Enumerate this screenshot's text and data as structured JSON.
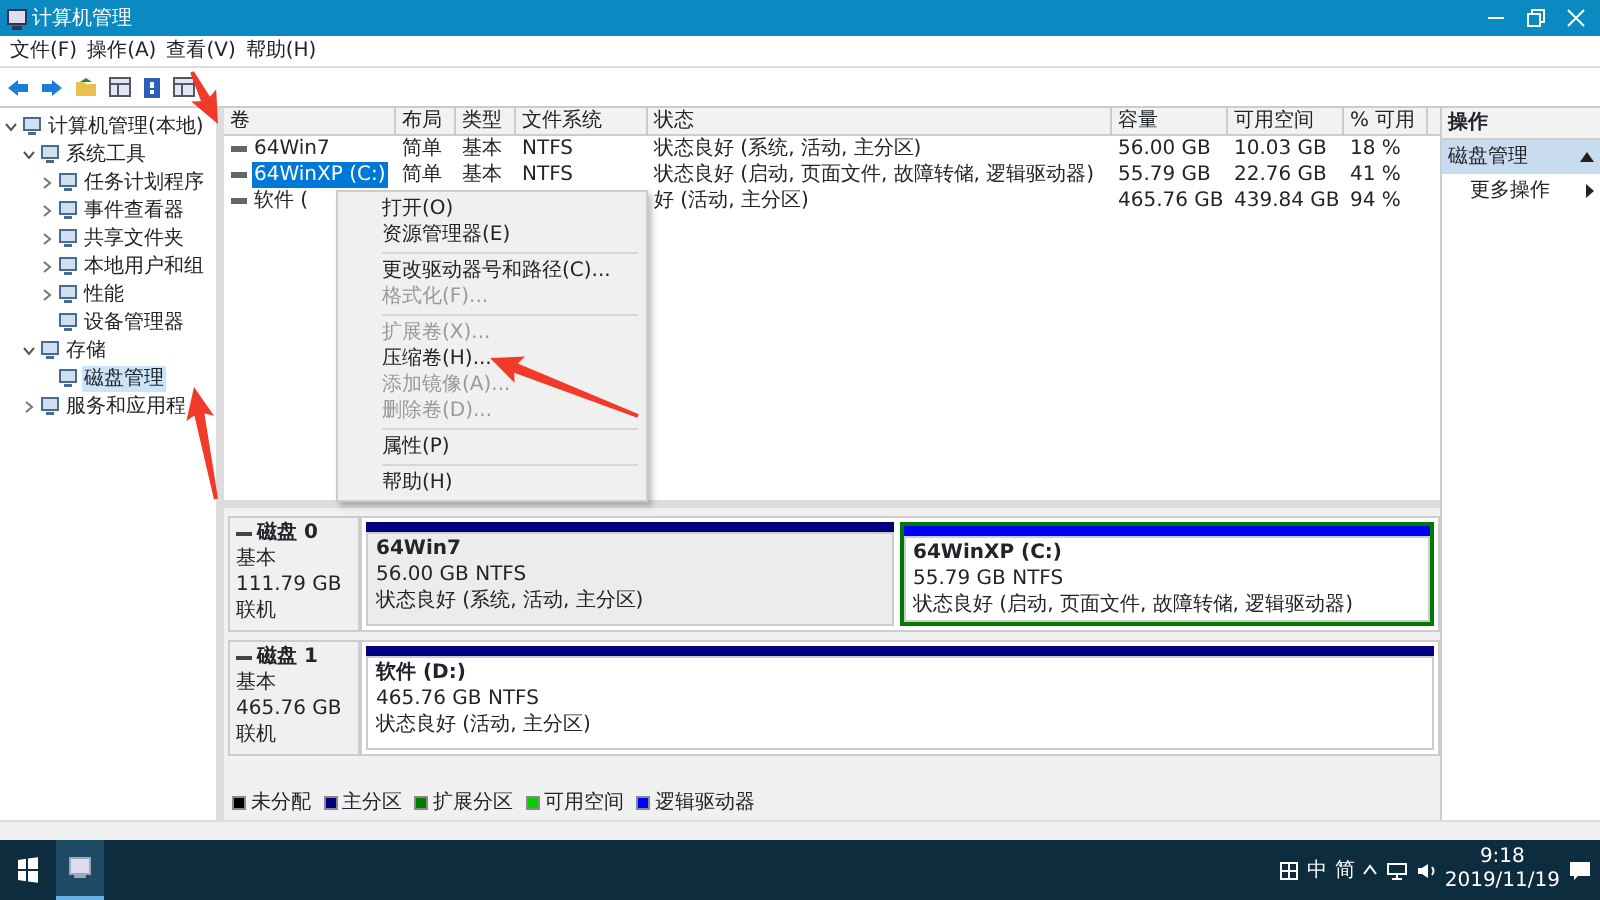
{
  "window": {
    "title": "计算机管理"
  },
  "menu_bar": [
    "文件(F)",
    "操作(A)",
    "查看(V)",
    "帮助(H)"
  ],
  "tree": [
    {
      "label": "计算机管理(本地)",
      "expanded": true,
      "selected": false,
      "children": [
        {
          "label": "系统工具",
          "expanded": true,
          "selected": false,
          "children": [
            {
              "label": "任务计划程序",
              "expanded": false,
              "selected": false
            },
            {
              "label": "事件查看器",
              "expanded": false,
              "selected": false
            },
            {
              "label": "共享文件夹",
              "expanded": false,
              "selected": false
            },
            {
              "label": "本地用户和组",
              "expanded": false,
              "selected": false
            },
            {
              "label": "性能",
              "expanded": false,
              "selected": false
            },
            {
              "label": "设备管理器",
              "selected": false
            }
          ]
        },
        {
          "label": "存储",
          "expanded": true,
          "selected": false,
          "children": [
            {
              "label": "磁盘管理",
              "selected": true
            }
          ]
        },
        {
          "label": "服务和应用程",
          "expanded": false,
          "selected": false
        }
      ]
    }
  ],
  "table": {
    "columns": [
      "卷",
      "布局",
      "类型",
      "文件系统",
      "状态",
      "容量",
      "可用空间",
      "% 可用"
    ],
    "rows": [
      {
        "selected": false,
        "cells": [
          "64Win7",
          "简单",
          "基本",
          "NTFS",
          "状态良好 (系统, 活动, 主分区)",
          "56.00 GB",
          "10.03 GB",
          "18 %"
        ]
      },
      {
        "selected": true,
        "cells": [
          "64WinXP (C:)",
          "简单",
          "基本",
          "NTFS",
          "状态良好 (启动, 页面文件, 故障转储, 逻辑驱动器)",
          "55.79 GB",
          "22.76 GB",
          "41 %"
        ]
      },
      {
        "selected": false,
        "cells": [
          "软件 (",
          "",
          "",
          "",
          "好 (活动, 主分区)",
          "465.76 GB",
          "439.84 GB",
          "94 %"
        ]
      }
    ]
  },
  "context_menu": [
    {
      "label": "打开(O)",
      "disabled": false
    },
    {
      "label": "资源管理器(E)",
      "disabled": false,
      "separator_after": true
    },
    {
      "label": "更改驱动器号和路径(C)...",
      "disabled": false
    },
    {
      "label": "格式化(F)...",
      "disabled": true,
      "separator_after": true
    },
    {
      "label": "扩展卷(X)...",
      "disabled": true
    },
    {
      "label": "压缩卷(H)...",
      "disabled": false
    },
    {
      "label": "添加镜像(A)...",
      "disabled": true
    },
    {
      "label": "删除卷(D)...",
      "disabled": true,
      "separator_after": true
    },
    {
      "label": "属性(P)",
      "disabled": false,
      "separator_after": true
    },
    {
      "label": "帮助(H)",
      "disabled": false
    }
  ],
  "disks": [
    {
      "name": "磁盘 0",
      "type": "基本",
      "size": "111.79 GB",
      "state": "联机",
      "partitions": [
        {
          "kind": "primary",
          "selected": true,
          "label": "64Win7",
          "size": "56.00 GB NTFS",
          "status": "状态良好 (系统, 活动, 主分区)"
        },
        {
          "kind": "logical",
          "selected": false,
          "label": "64WinXP   (C:)",
          "size": "55.79 GB NTFS",
          "status": "状态良好 (启动, 页面文件, 故障转储, 逻辑驱动器)"
        }
      ]
    },
    {
      "name": "磁盘 1",
      "type": "基本",
      "size": "465.76 GB",
      "state": "联机",
      "partitions": [
        {
          "kind": "primary",
          "selected": false,
          "label": "软件 (D:)",
          "size": "465.76 GB NTFS",
          "status": "状态良好 (活动, 主分区)"
        }
      ]
    }
  ],
  "legend": [
    {
      "label": "未分配",
      "color": "#000000"
    },
    {
      "label": "主分区",
      "color": "#000080"
    },
    {
      "label": "扩展分区",
      "color": "#007a00"
    },
    {
      "label": "可用空间",
      "color": "#00d000"
    },
    {
      "label": "逻辑驱动器",
      "color": "#0000ff"
    }
  ],
  "actions": {
    "title": "操作",
    "section": {
      "label": "磁盘管理",
      "expanded": true
    },
    "items": [
      "更多操作"
    ]
  },
  "taskbar": {
    "ime": [
      "中",
      "简"
    ],
    "time": "9:18",
    "date": "2019/11/19"
  }
}
